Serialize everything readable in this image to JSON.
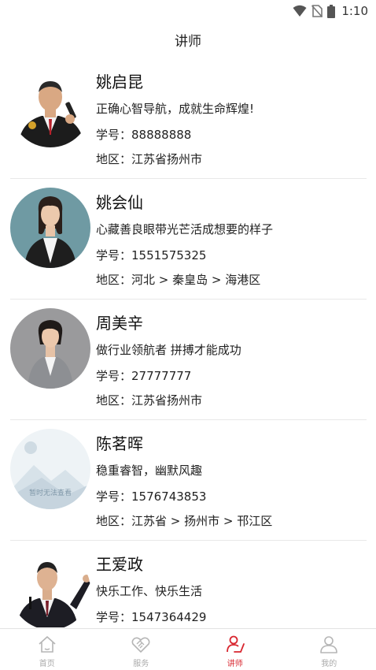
{
  "status_bar": {
    "time": "1:10"
  },
  "header": {
    "title": "讲师"
  },
  "lecturers": [
    {
      "name": "姚启昆",
      "motto": "正确心智导航，成就生命辉煌!",
      "student_id": "学号：88888888",
      "region": "地区：江苏省扬州市",
      "avatar": "man-suit-microphone-photo"
    },
    {
      "name": "姚会仙",
      "motto": "心藏善良眼带光芒活成想要的样子",
      "student_id": "学号：1551575325",
      "region": "地区：河北 > 秦皇岛 > 海港区",
      "avatar": "woman-black-suit-photo"
    },
    {
      "name": "周美辛",
      "motto": "做行业领航者 拼搏才能成功",
      "student_id": "学号：27777777",
      "region": "地区：江苏省扬州市",
      "avatar": "woman-gray-suit-photo"
    },
    {
      "name": "陈茗晖",
      "motto": "稳重睿智，幽默风趣",
      "student_id": "学号：1576743853",
      "region": "地区：江苏省 > 扬州市 > 邗江区",
      "avatar": "image-placeholder",
      "avatar_placeholder_text": "暂时无法查看"
    },
    {
      "name": "王爱政",
      "motto": "快乐工作、快乐生活",
      "student_id": "学号：1547364429",
      "region": "",
      "avatar": "man-speaking-microphone-photo"
    }
  ],
  "tab_bar": {
    "active": "讲师",
    "accent_color": "#d8262f",
    "inactive_color": "#aaaaaa",
    "tabs": [
      {
        "label": "首页",
        "icon": "home-icon"
      },
      {
        "label": "服务",
        "icon": "handshake-icon"
      },
      {
        "label": "讲师",
        "icon": "lecturer-icon"
      },
      {
        "label": "我的",
        "icon": "user-icon"
      }
    ]
  }
}
